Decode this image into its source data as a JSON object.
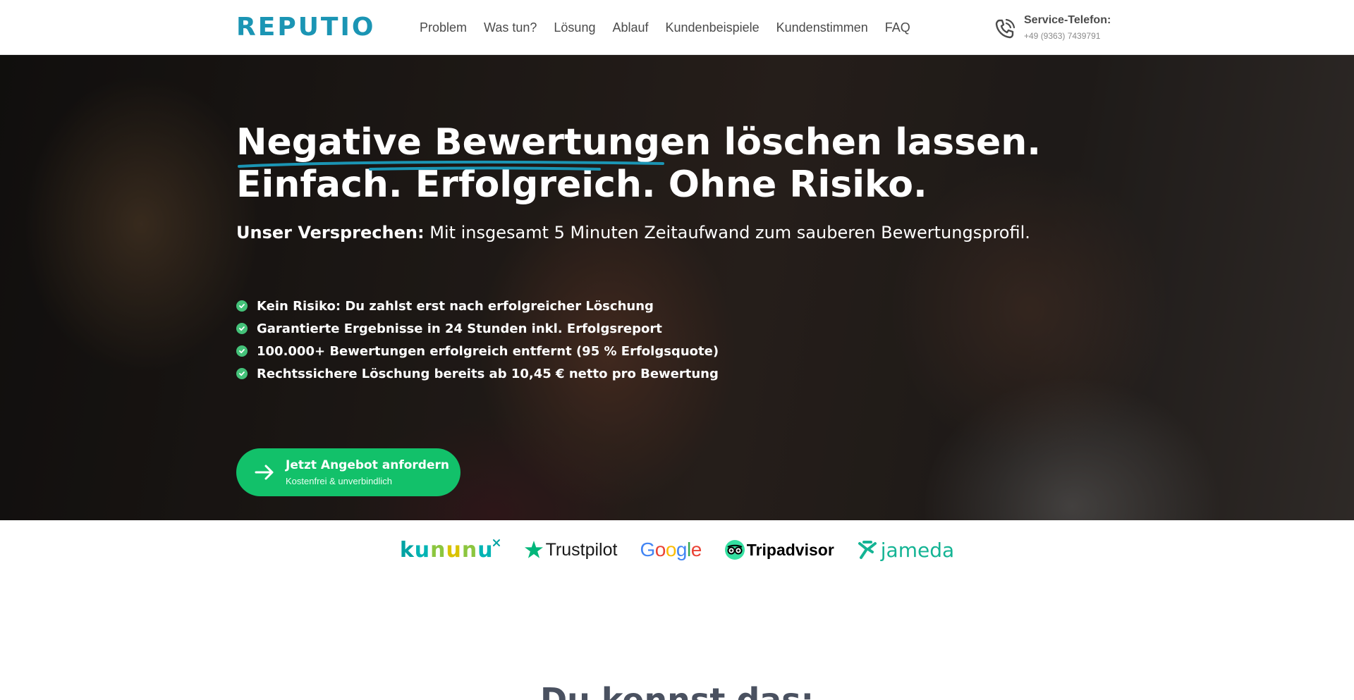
{
  "header": {
    "logo": "REPUTIO",
    "nav": [
      "Problem",
      "Was tun?",
      "Lösung",
      "Ablauf",
      "Kundenbeispiele",
      "Kundenstimmen",
      "FAQ"
    ],
    "phone_label": "Service-Telefon:",
    "phone_number": "+49 (9363) 7439791",
    "phone_icon": "phone-icon"
  },
  "hero": {
    "headline_highlight": "Negative Bewertungen",
    "headline_rest": " löschen lassen.",
    "headline_line2": "Einfach. Erfolgreich. Ohne Risiko.",
    "subline_bold": "Unser Versprechen:",
    "subline_text": " Mit insgesamt 5 Minuten Zeitaufwand zum sauberen Bewertungsprofil.",
    "bullets": [
      "Kein Risiko: Du zahlst erst nach erfolgreicher Löschung",
      "Garantierte Ergebnisse in 24 Stunden inkl. Erfolgsreport",
      "100.000+ Bewertungen erfolgreich entfernt (95 % Erfolgsquote)",
      "Rechtssichere Löschung bereits ab 10,45 € netto pro Bewertung"
    ],
    "cta_title": "Jetzt Angebot anfordern",
    "cta_subtitle": "Kostenfrei & unverbindlich"
  },
  "platforms": {
    "kununu": "kununu",
    "trustpilot": "Trustpilot",
    "google": [
      "G",
      "o",
      "o",
      "g",
      "l",
      "e"
    ],
    "tripadvisor": "Tripadvisor",
    "jameda": "jameda"
  },
  "next_section_heading": "Du kennst das:",
  "colors": {
    "brand": "#1b95b4",
    "cta": "#12c16a",
    "check": "#44c279",
    "jameda": "#14b494",
    "trustpilot_star": "#00b67a"
  }
}
